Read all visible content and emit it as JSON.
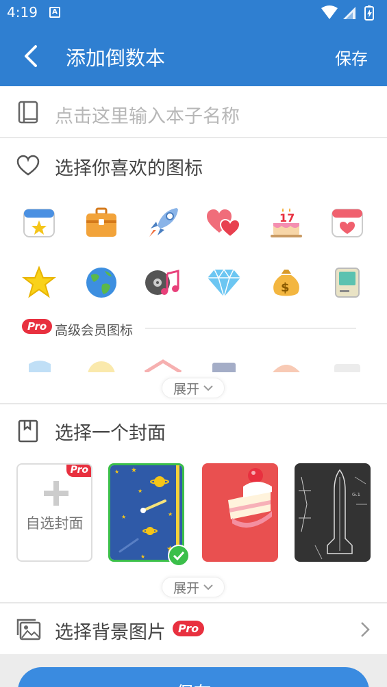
{
  "status": {
    "time": "4:19",
    "notification_icon": "A"
  },
  "appbar": {
    "title": "添加倒数本",
    "save_label": "保存"
  },
  "name_input": {
    "placeholder": "点击这里输入本子名称"
  },
  "icon_section": {
    "title": "选择你喜欢的图标",
    "icons_row1": [
      "calendar-star-icon",
      "briefcase-icon",
      "rocket-icon",
      "hearts-icon",
      "birthday-cake-icon",
      "calendar-heart-icon"
    ],
    "icons_row2": [
      "star-icon",
      "earth-icon",
      "music-record-icon",
      "diamond-icon",
      "money-bag-icon",
      "retro-computer-icon"
    ],
    "pro_badge": "Pro",
    "pro_label": "高级会员图标",
    "expand_label": "展开"
  },
  "cover_section": {
    "title": "选择一个封面",
    "custom_label": "自选封面",
    "pro_badge": "Pro",
    "covers": [
      "starry-night-cover",
      "strawberry-cake-cover",
      "space-shuttle-blueprint-cover"
    ],
    "selected": "starry-night-cover",
    "expand_label": "展开"
  },
  "background_section": {
    "title": "选择背景图片",
    "pro_badge": "Pro"
  },
  "bottom_button": {
    "label": "保存"
  },
  "colors": {
    "primary": "#2f7fd1",
    "pro_red": "#e8303f",
    "selected_green": "#3bbf4a"
  }
}
